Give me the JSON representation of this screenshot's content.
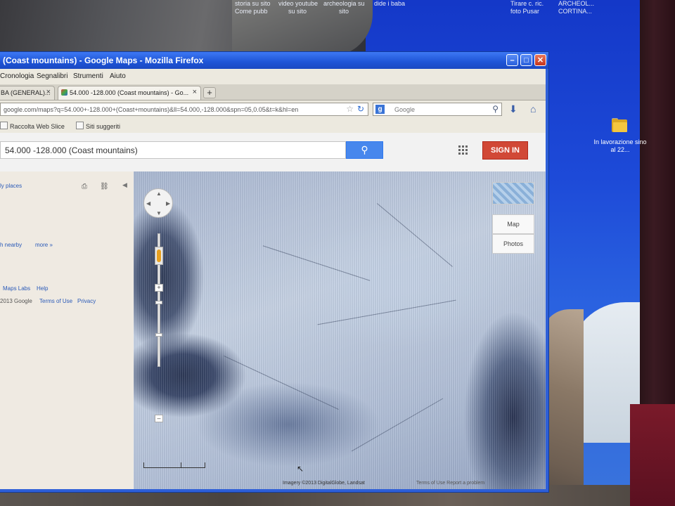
{
  "desktop": {
    "top_texts": [
      "storia su sito",
      "video youtube",
      "archeologia su",
      "dide i baba",
      "Tirare c. ric.",
      "ARCHEOL...",
      "Come pubb",
      "su sito",
      "sito",
      "foto Pusar",
      "CORTINA..."
    ],
    "folder_label": "In lavorazione sino al 22..."
  },
  "window": {
    "title": "(Coast mountains) - Google Maps - Mozilla Firefox",
    "controls": {
      "minimize": "–",
      "maximize": "□",
      "close": "✕"
    }
  },
  "menubar": [
    "Cronologia",
    "Segnalibri",
    "Strumenti",
    "Aiuto"
  ],
  "tabs": [
    {
      "label": "BA (GENERAL)...",
      "active": false
    },
    {
      "label": "54.000 -128.000 (Coast mountains) - Go...",
      "active": true
    }
  ],
  "new_tab_label": "+",
  "navbar": {
    "url": "google.com/maps?q=54.000+-128.000+(Coast+mountains)&ll=54.000,-128.000&spn=05,0.05&t=k&hl=en",
    "search_engine_letter": "g",
    "search_placeholder": "Google"
  },
  "bookmarks": [
    "Raccolta Web Slice",
    "Siti suggeriti"
  ],
  "maps_header": {
    "search_query": "54.000 -128.000 (Coast mountains)",
    "sign_in": "SIGN IN"
  },
  "left_panel": {
    "my_places": "ly places",
    "nearby": "h nearby",
    "more": "more »",
    "labs": "Maps Labs",
    "help": "Help",
    "copyright": "2013 Google",
    "terms": "Terms of Use",
    "privacy": "Privacy"
  },
  "map": {
    "map_type_buttons": [
      "Map",
      "Photos"
    ],
    "pan_arrows": {
      "up": "▲",
      "down": "▼",
      "left": "◀",
      "right": "▶"
    },
    "zoom_in": "+",
    "zoom_out": "–",
    "attribution": "Imagery ©2013 DigitalGlobe, Landsat",
    "attribution_extra": "Terms of Use   Report a problem"
  }
}
